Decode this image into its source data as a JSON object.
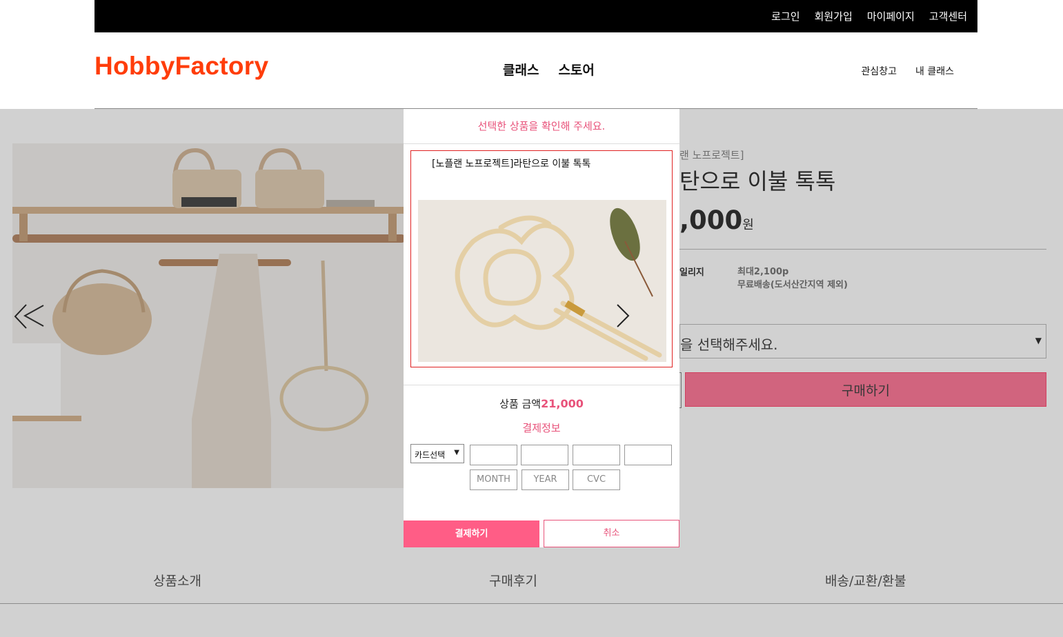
{
  "topbar": {
    "links": [
      "로그인",
      "회원가입",
      "마이페이지",
      "고객센터"
    ]
  },
  "header": {
    "logo": "HobbyFactory",
    "nav": [
      "클래스",
      "스토어"
    ],
    "subnav": [
      "관심창고",
      "내 클래스"
    ]
  },
  "product": {
    "brand_partial": "랜 노프로젝트]",
    "title_partial": "탄으로 이불 톡톡",
    "price_partial": ",000",
    "price_unit": "원",
    "mileage_label_partial": "일리지",
    "mileage_value": "최대2,100p",
    "shipping": "무료배송(도서산간지역 제외)",
    "option_placeholder_partial": "을 선택해주세요.",
    "buy_label": "구매하기"
  },
  "tabs": [
    "상품소개",
    "구매후기",
    "배송/교환/환불"
  ],
  "modal": {
    "title": "선택한 상품을 확인해 주세요.",
    "product_name": "[노플랜 노프로젝트]라탄으로 이불 톡톡",
    "price_label": "상품 금액",
    "price_value": "21,000",
    "payment_title": "결제정보",
    "card_select": "카드선택",
    "month_placeholder": "MONTH",
    "year_placeholder": "YEAR",
    "cvc_placeholder": "CVC",
    "pay_button": "결제하기",
    "cancel_button": "취소"
  },
  "colors": {
    "logo": "#ff3d0a",
    "accent": "#e8527a",
    "pay_button": "#ff5d86"
  },
  "icons": {
    "gallery_prev": "chevron-left-icon",
    "gallery_next": "chevron-right-icon",
    "select_arrow": "caret-down-icon"
  }
}
